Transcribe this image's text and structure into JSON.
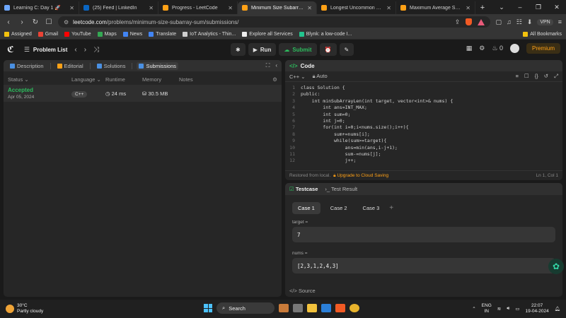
{
  "browser": {
    "tabs": [
      {
        "title": "Learning C: Day 1 🚀",
        "color": "#6ea8fe",
        "active": false
      },
      {
        "title": "(25) Feed | LinkedIn",
        "color": "#0a66c2",
        "active": false
      },
      {
        "title": "Progress - LeetCode",
        "color": "#ffa116",
        "active": false
      },
      {
        "title": "Minimum Size Subarray Su",
        "color": "#ffa116",
        "active": true
      },
      {
        "title": "Longest Uncommon Subseque",
        "color": "#ffa116",
        "active": false
      },
      {
        "title": "Maximum Average Subarray I",
        "color": "#ffa116",
        "active": false
      }
    ],
    "address": {
      "host": "leetcode.com",
      "path": "/problems/minimum-size-subarray-sum/submissions/"
    },
    "vpn_label": "VPN",
    "bookmarks": [
      {
        "label": "Assigned",
        "color": "#f4c20d"
      },
      {
        "label": "Gmail",
        "color": "#ea4335"
      },
      {
        "label": "YouTube",
        "color": "#ff0000"
      },
      {
        "label": "Maps",
        "color": "#34a853"
      },
      {
        "label": "News",
        "color": "#4285f4"
      },
      {
        "label": "Translate",
        "color": "#4285f4"
      },
      {
        "label": "IoT Analytics - Thin...",
        "color": "#cfcfcf"
      },
      {
        "label": "Explore all Services",
        "color": "#eeeeee"
      },
      {
        "label": "Blynk: a low-code I...",
        "color": "#23c48e"
      }
    ],
    "all_bookmarks": "All Bookmarks"
  },
  "leetcode": {
    "problem_list": "Problem List",
    "run": "Run",
    "submit": "Submit",
    "streak": "0",
    "premium": "Premium"
  },
  "left": {
    "tabs": [
      {
        "label": "Description",
        "color": "#4a90e2",
        "active": false
      },
      {
        "label": "Editorial",
        "color": "#ffa116",
        "active": false
      },
      {
        "label": "Solutions",
        "color": "#4a90e2",
        "active": false
      },
      {
        "label": "Submissions",
        "color": "#4a90e2",
        "active": true
      }
    ],
    "columns": {
      "status": "Status",
      "language": "Language",
      "runtime": "Runtime",
      "memory": "Memory",
      "notes": "Notes"
    },
    "submission": {
      "status": "Accepted",
      "date": "Apr 05, 2024",
      "language": "C++",
      "runtime": "24 ms",
      "memory": "30.5 MB"
    }
  },
  "code": {
    "title": "Code",
    "language": "C++",
    "mode": "Auto",
    "lines": [
      "class Solution {",
      "public:",
      "    int minSubArrayLen(int target, vector<int>& nums) {",
      "        int ans=INT_MAX;",
      "        int sum=0;",
      "        int j=0;",
      "        for(int i=0;i<nums.size();i++){",
      "            sum+=nums[i];",
      "            while(sum>=target){",
      "                ans=min(ans,i-j+1);",
      "                sum-=nums[j];",
      "                j++;"
    ],
    "line_numbers": [
      "1",
      "2",
      "3",
      "4",
      "5",
      "6",
      "7",
      "8",
      "9",
      "10",
      "11",
      "12"
    ],
    "footer_left": "Restored from local.",
    "footer_upgrade": "Upgrade to Cloud Saving",
    "footer_right": "Ln 1, Col 1"
  },
  "tests": {
    "tab_testcase": "Testcase",
    "tab_result": "Test Result",
    "cases": [
      "Case 1",
      "Case 2",
      "Case 3"
    ],
    "fields": [
      {
        "label": "target =",
        "value": "7"
      },
      {
        "label": "nums =",
        "value": "[2,3,1,2,4,3]"
      }
    ],
    "source": "Source"
  },
  "taskbar": {
    "temp": "30°C",
    "weather": "Partly cloudy",
    "search": "Search",
    "lang1": "ENG",
    "lang2": "IN",
    "time": "22:07",
    "date": "19-04-2024"
  }
}
